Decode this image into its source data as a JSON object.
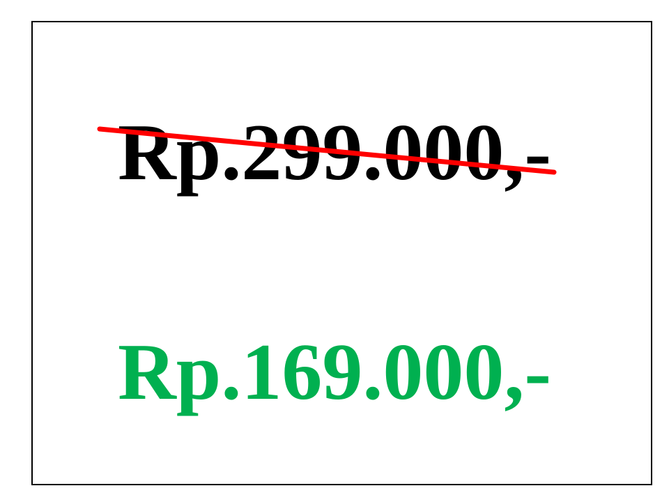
{
  "old_price": {
    "text": "Rp.299.000,-",
    "color": "#000000",
    "struck_through": true,
    "strike_color": "#ff0000"
  },
  "new_price": {
    "text": "Rp.169.000,-",
    "color": "#00b050"
  }
}
